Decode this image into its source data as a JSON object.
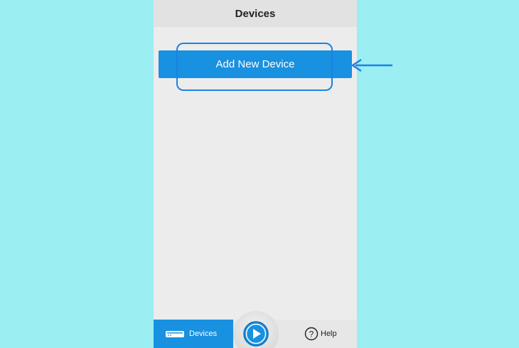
{
  "header": {
    "title": "Devices"
  },
  "main": {
    "add_device_label": "Add New Device"
  },
  "tabbar": {
    "devices_label": "Devices",
    "help_label": "Help",
    "active_tab": "Devices"
  },
  "colors": {
    "accent": "#1891e0",
    "annotation": "#1a82e6",
    "page_background": "#9beef2"
  },
  "icons": {
    "devices_tab": "router-device-icon",
    "play": "play-icon",
    "help": "question-circle-icon",
    "annotation": "left-arrow-icon"
  }
}
